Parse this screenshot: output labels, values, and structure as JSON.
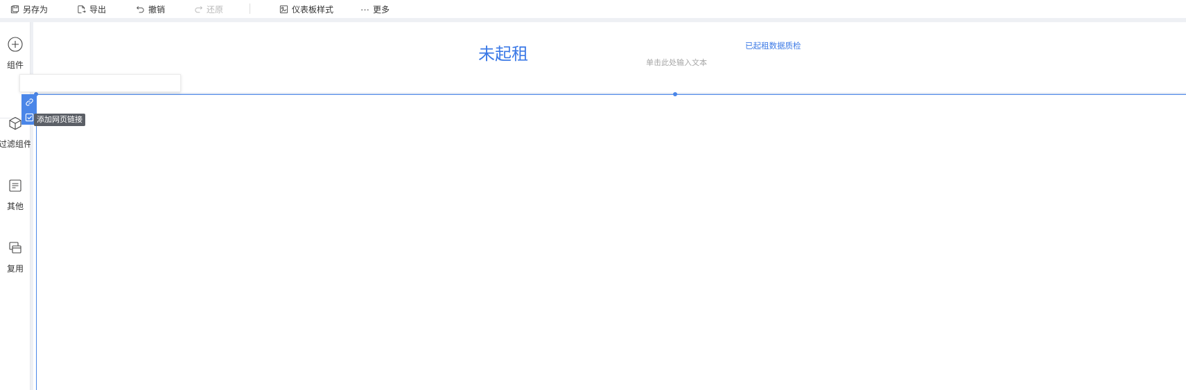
{
  "toolbar": {
    "save_as": "另存为",
    "export": "导出",
    "undo": "撤销",
    "redo": "还原",
    "dashboard_style": "仪表板样式",
    "more": "更多"
  },
  "rail": {
    "components": "组件",
    "filter_components": "过滤组件",
    "other": "其他",
    "reuse": "复用"
  },
  "canvas": {
    "title": "未起租",
    "placeholder_text": "单击此处输入文本",
    "qc_link": "已起租数据质检"
  },
  "popup": {
    "input_value": "",
    "tooltip": "添加网页链接"
  },
  "colors": {
    "accent": "#3b79e6",
    "selection": "#4a86e8",
    "tooltip_bg": "#5b5f66"
  }
}
